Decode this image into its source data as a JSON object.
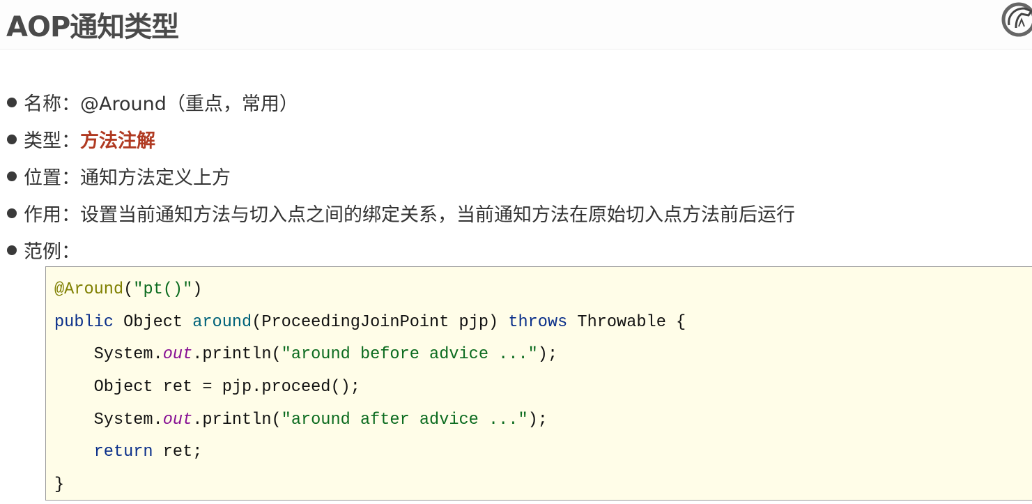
{
  "header": {
    "title": "AOP通知类型",
    "logo_icon": "horse-head-logo"
  },
  "bullets": [
    {
      "label": "名称：",
      "value": "@Around（重点，常用）"
    },
    {
      "label": "类型：",
      "value": "方法注解"
    },
    {
      "label": "位置：",
      "value": "通知方法定义上方"
    },
    {
      "label": "作用：",
      "value": "设置当前通知方法与切入点之间的绑定关系，当前通知方法在原始切入点方法前后运行"
    },
    {
      "label": "范例：",
      "value": ""
    }
  ],
  "code": {
    "l1": {
      "ann": "@Around",
      "p1": "(",
      "str": "\"pt()\"",
      "p2": ")"
    },
    "l2": {
      "kw1": "public",
      "t1": " Object ",
      "fn": "around",
      "t2": "(ProceedingJoinPoint pjp) ",
      "kw2": "throws",
      "t3": " Throwable {"
    },
    "l3": {
      "t1": "    System.",
      "fld": "out",
      "t2": ".println(",
      "str": "\"around before advice ...\"",
      "t3": ");"
    },
    "l4": {
      "t1": "    Object ret = pjp.proceed();"
    },
    "l5": {
      "t1": "    System.",
      "fld": "out",
      "t2": ".println(",
      "str": "\"around after advice ...\"",
      "t3": ");"
    },
    "l6": {
      "kw": "    return",
      "t1": " ret;"
    },
    "l7": {
      "t1": "}"
    }
  }
}
